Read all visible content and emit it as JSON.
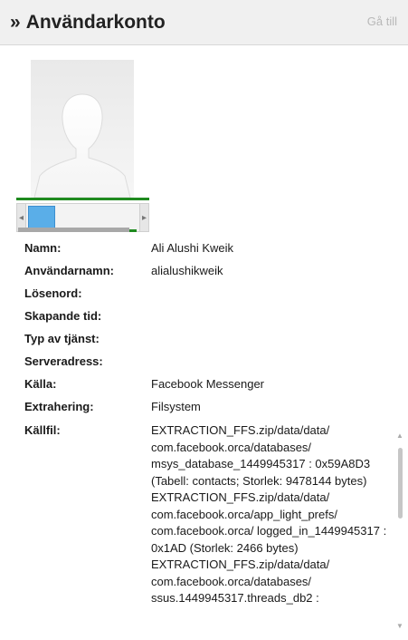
{
  "header": {
    "title": "Användarkonto",
    "chevron_icon": "double-chevron-right-icon",
    "goto_label": "Gå till"
  },
  "photo": {
    "icon": "default-user-silhouette-icon"
  },
  "thumbnail_strip": {
    "left_arrow": "◂",
    "right_arrow": "▸"
  },
  "fields": [
    {
      "label": "Namn:",
      "value": "Ali Alushi Kweik"
    },
    {
      "label": "Användarnamn:",
      "value": "alialushikweik"
    },
    {
      "label": "Lösenord:",
      "value": ""
    },
    {
      "label": "Skapande tid:",
      "value": ""
    },
    {
      "label": "Typ av tjänst:",
      "value": ""
    },
    {
      "label": "Serveradress:",
      "value": ""
    },
    {
      "label": "Källa:",
      "value": "Facebook Messenger"
    },
    {
      "label": "Extrahering:",
      "value": "Filsystem"
    }
  ],
  "source_file": {
    "label": "Källfil:",
    "entries": [
      "EXTRACTION_FFS.zip/data/data/ com.facebook.orca/databases/ msys_database_1449945317 : 0x59A8D3 (Tabell: contacts; Storlek: 9478144 bytes)",
      "EXTRACTION_FFS.zip/data/data/ com.facebook.orca/app_light_prefs/ com.facebook.orca/ logged_in_1449945317 : 0x1AD (Storlek: 2466 bytes)",
      "EXTRACTION_FFS.zip/data/data/ com.facebook.orca/databases/ ssus.1449945317.threads_db2 :"
    ],
    "scroll_up": "▲",
    "scroll_down": "▼"
  }
}
